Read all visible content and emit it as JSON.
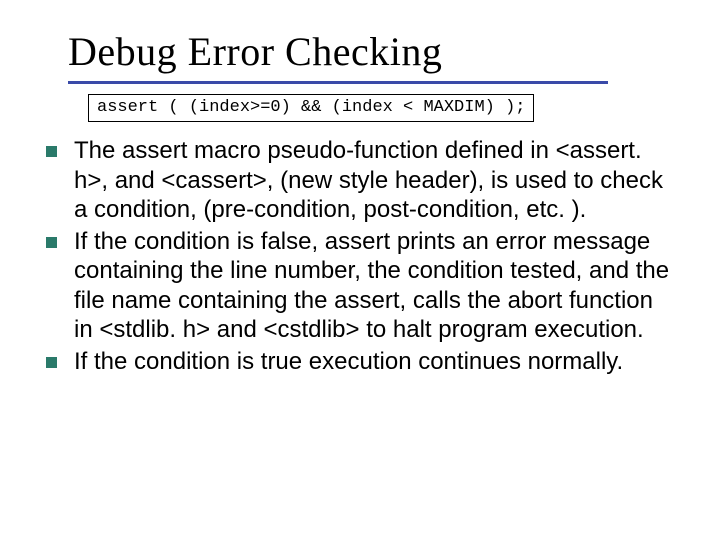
{
  "title": "Debug Error Checking",
  "code": "assert ( (index>=0) && (index < MAXDIM) );",
  "bullets": [
    "The assert macro pseudo-function defined in <assert. h>, and <cassert>, (new style header), is used to check a condition, (pre-condition, post-condition, etc. ).",
    "If the condition is false, assert prints an error message containing the line number, the condition tested, and the file name containing the assert, calls the abort function in <stdlib. h> and <cstdlib> to halt program execution.",
    "If the condition is true execution continues normally."
  ]
}
